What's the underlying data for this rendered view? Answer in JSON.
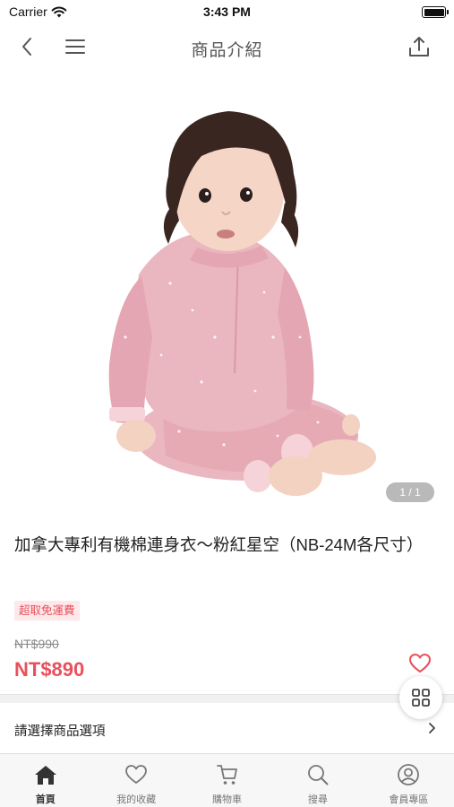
{
  "status_bar": {
    "carrier": "Carrier",
    "time": "3:43 PM"
  },
  "nav": {
    "title": "商品介紹",
    "back_icon": "chevron-left-icon",
    "menu_icon": "hamburger-menu-icon",
    "share_icon": "share-icon"
  },
  "product": {
    "image_counter": "1 / 1",
    "title": "加拿大專利有機棉連身衣～粉紅星空（NB-24M各尺寸）",
    "promo_badge": "超取免運費",
    "original_price": "NT$990",
    "sale_price": "NT$890"
  },
  "options": {
    "label": "請選擇商品選項"
  },
  "tabs": [
    {
      "label": "首頁",
      "icon": "home-icon",
      "active": true
    },
    {
      "label": "我的收藏",
      "icon": "heart-icon",
      "active": false
    },
    {
      "label": "購物車",
      "icon": "cart-icon",
      "active": false
    },
    {
      "label": "搜尋",
      "icon": "search-icon",
      "active": false
    },
    {
      "label": "會員專區",
      "icon": "user-icon",
      "active": false
    }
  ],
  "colors": {
    "accent": "#e8505b",
    "promo_bg": "#fde8ea",
    "product_pink": "#eab6bf"
  }
}
